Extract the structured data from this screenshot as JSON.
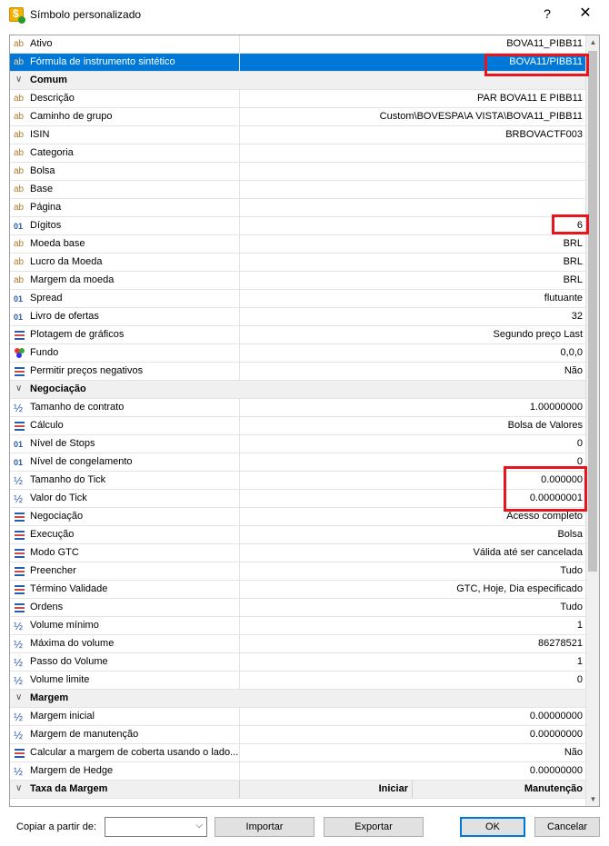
{
  "window": {
    "title": "Símbolo personalizado",
    "help": "?",
    "close": "✕"
  },
  "rows": [
    {
      "type": "prop",
      "icon": "ab",
      "label": "Ativo",
      "value": "BOVA11_PIBB11"
    },
    {
      "type": "prop",
      "icon": "ab",
      "label": "Fórmula de instrumento sintético",
      "value": "BOVA11/PIBB11",
      "selected": true
    },
    {
      "type": "group",
      "label": "Comum"
    },
    {
      "type": "prop",
      "icon": "ab",
      "label": "Descrição",
      "value": "PAR BOVA11 E PIBB11"
    },
    {
      "type": "prop",
      "icon": "ab",
      "label": "Caminho de grupo",
      "value": "Custom\\BOVESPA\\A VISTA\\BOVA11_PIBB11"
    },
    {
      "type": "prop",
      "icon": "ab",
      "label": "ISIN",
      "value": "BRBOVACTF003"
    },
    {
      "type": "prop",
      "icon": "ab",
      "label": "Categoria",
      "value": ""
    },
    {
      "type": "prop",
      "icon": "ab",
      "label": "Bolsa",
      "value": ""
    },
    {
      "type": "prop",
      "icon": "ab",
      "label": "Base",
      "value": ""
    },
    {
      "type": "prop",
      "icon": "ab",
      "label": "Página",
      "value": ""
    },
    {
      "type": "prop",
      "icon": "num",
      "label": "Dígitos",
      "value": "6"
    },
    {
      "type": "prop",
      "icon": "ab",
      "label": "Moeda base",
      "value": "BRL"
    },
    {
      "type": "prop",
      "icon": "ab",
      "label": "Lucro da Moeda",
      "value": "BRL"
    },
    {
      "type": "prop",
      "icon": "ab",
      "label": "Margem da moeda",
      "value": "BRL"
    },
    {
      "type": "prop",
      "icon": "num",
      "label": "Spread",
      "value": "flutuante"
    },
    {
      "type": "prop",
      "icon": "num",
      "label": "Livro de ofertas",
      "value": "32"
    },
    {
      "type": "prop",
      "icon": "list",
      "label": "Plotagem de gráficos",
      "value": "Segundo preço Last"
    },
    {
      "type": "prop",
      "icon": "color",
      "label": "Fundo",
      "value": "0,0,0"
    },
    {
      "type": "prop",
      "icon": "list",
      "label": "Permitir preços negativos",
      "value": "Não"
    },
    {
      "type": "group",
      "label": "Negociação"
    },
    {
      "type": "prop",
      "icon": "half",
      "label": "Tamanho de contrato",
      "value": "1.00000000"
    },
    {
      "type": "prop",
      "icon": "list",
      "label": "Cálculo",
      "value": "Bolsa de Valores"
    },
    {
      "type": "prop",
      "icon": "num",
      "label": "Nível de Stops",
      "value": "0"
    },
    {
      "type": "prop",
      "icon": "num",
      "label": "Nível de congelamento",
      "value": "0"
    },
    {
      "type": "prop",
      "icon": "half",
      "label": "Tamanho do Tick",
      "value": "0.000000"
    },
    {
      "type": "prop",
      "icon": "half",
      "label": "Valor do Tick",
      "value": "0.00000001"
    },
    {
      "type": "prop",
      "icon": "list",
      "label": "Negociação",
      "value": "Acesso completo"
    },
    {
      "type": "prop",
      "icon": "list",
      "label": "Execução",
      "value": "Bolsa"
    },
    {
      "type": "prop",
      "icon": "list",
      "label": "Modo GTC",
      "value": "Válida até ser cancelada"
    },
    {
      "type": "prop",
      "icon": "list",
      "label": "Preencher",
      "value": "Tudo"
    },
    {
      "type": "prop",
      "icon": "list",
      "label": "Término Validade",
      "value": "GTC, Hoje, Dia especificado"
    },
    {
      "type": "prop",
      "icon": "list",
      "label": "Ordens",
      "value": "Tudo"
    },
    {
      "type": "prop",
      "icon": "half",
      "label": "Volume mínimo",
      "value": "1"
    },
    {
      "type": "prop",
      "icon": "half",
      "label": "Máxima do volume",
      "value": "86278521"
    },
    {
      "type": "prop",
      "icon": "half",
      "label": "Passo do Volume",
      "value": "1"
    },
    {
      "type": "prop",
      "icon": "half",
      "label": "Volume limite",
      "value": "0"
    },
    {
      "type": "group",
      "label": "Margem"
    },
    {
      "type": "prop",
      "icon": "half",
      "label": "Margem inicial",
      "value": "0.00000000"
    },
    {
      "type": "prop",
      "icon": "half",
      "label": "Margem de manutenção",
      "value": "0.00000000"
    },
    {
      "type": "prop",
      "icon": "list",
      "label": "Calcular a margem de coberta usando o lado...",
      "value": "Não"
    },
    {
      "type": "prop",
      "icon": "half",
      "label": "Margem de Hedge",
      "value": "0.00000000"
    },
    {
      "type": "group",
      "label": "Taxa da Margem",
      "col1": "Iniciar",
      "col2": "Manutenção"
    }
  ],
  "footer": {
    "copy_label": "Copiar a partir de:",
    "copy_value": "",
    "import": "Importar",
    "export": "Exportar",
    "ok": "OK",
    "cancel": "Cancelar"
  },
  "colors": {
    "selection": "#0078d7",
    "highlight": "#e8141e"
  }
}
